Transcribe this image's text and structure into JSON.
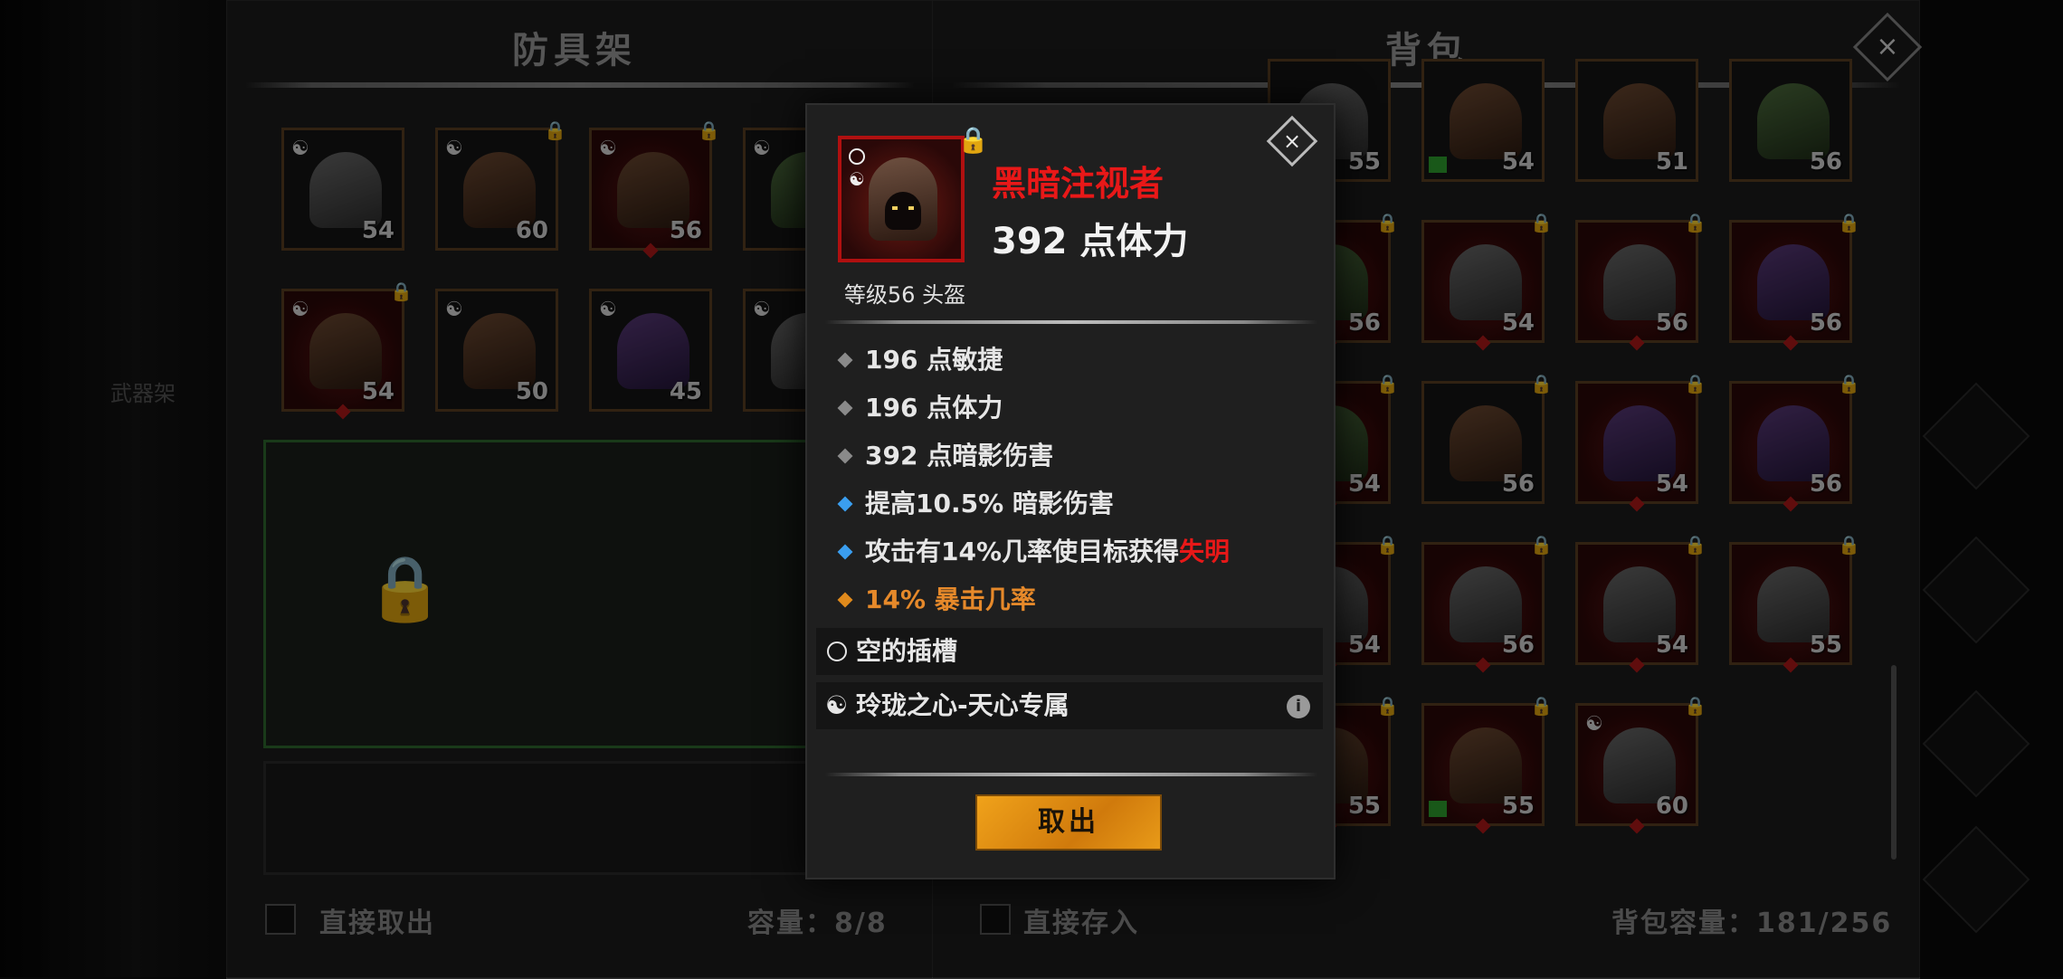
{
  "armor_rack": {
    "title": "防具架",
    "items": [
      {
        "level": "54",
        "socket": "☯",
        "locked": false,
        "style": "grey",
        "red": false
      },
      {
        "level": "60",
        "socket": "☯",
        "locked": true,
        "style": "brown",
        "red": false
      },
      {
        "level": "56",
        "socket": "☯",
        "locked": true,
        "style": "brown",
        "red": true
      },
      {
        "level": "",
        "socket": "☯",
        "locked": false,
        "style": "green",
        "red": false
      },
      {
        "level": "54",
        "socket": "☯",
        "locked": true,
        "style": "brown",
        "red": true
      },
      {
        "level": "50",
        "socket": "☯",
        "locked": false,
        "style": "brown",
        "red": false
      },
      {
        "level": "45",
        "socket": "☯",
        "locked": false,
        "style": "purple",
        "red": false
      },
      {
        "level": "",
        "socket": "☯",
        "locked": false,
        "style": "grey",
        "red": false
      }
    ],
    "direct_take_label": "直接取出",
    "capacity_label": "容量：8/8"
  },
  "backpack": {
    "title": "背包",
    "items": [
      {
        "level": "55",
        "locked": false,
        "style": "grey",
        "red": false
      },
      {
        "level": "54",
        "locked": false,
        "style": "brown",
        "red": false,
        "book": true
      },
      {
        "level": "51",
        "locked": false,
        "style": "brown",
        "red": false
      },
      {
        "level": "56",
        "locked": false,
        "style": "green",
        "red": false
      },
      {
        "level": "56",
        "locked": true,
        "style": "green",
        "red": true
      },
      {
        "level": "54",
        "locked": true,
        "style": "grey",
        "red": true
      },
      {
        "level": "56",
        "locked": true,
        "style": "grey",
        "red": true
      },
      {
        "level": "56",
        "locked": true,
        "style": "purple",
        "red": true
      },
      {
        "level": "54",
        "locked": true,
        "style": "green",
        "red": true
      },
      {
        "level": "56",
        "locked": true,
        "style": "brown",
        "red": false
      },
      {
        "level": "54",
        "locked": true,
        "style": "purple",
        "red": true
      },
      {
        "level": "56",
        "locked": true,
        "style": "purple",
        "red": true
      },
      {
        "level": "54",
        "locked": true,
        "style": "grey",
        "red": true
      },
      {
        "level": "56",
        "locked": true,
        "style": "grey",
        "red": true
      },
      {
        "level": "54",
        "locked": true,
        "style": "grey",
        "red": true
      },
      {
        "level": "55",
        "locked": true,
        "style": "grey",
        "red": true
      },
      {
        "level": "55",
        "locked": true,
        "style": "brown",
        "red": true
      },
      {
        "level": "55",
        "locked": true,
        "style": "brown",
        "red": true,
        "book": true
      },
      {
        "level": "60",
        "locked": true,
        "style": "grey",
        "red": true,
        "socket": "☯"
      }
    ],
    "direct_store_label": "直接存入",
    "capacity_label": "背包容量：181/256"
  },
  "side_menu_label": "武器架",
  "item_tooltip": {
    "name": "黑暗注视者",
    "main_stat": "392 点体力",
    "type": "等级56 头盔",
    "attributes": [
      {
        "text": "196 点敏捷",
        "color": "grey"
      },
      {
        "text": "196 点体力",
        "color": "grey"
      },
      {
        "text": "392 点暗影伤害",
        "color": "grey"
      },
      {
        "text": "提高10.5% 暗影伤害",
        "color": "blue"
      },
      {
        "text": "攻击有14%几率使目标获得",
        "highlight": "失明",
        "color": "blue"
      },
      {
        "text": "14% 暴击几率",
        "color": "orange"
      }
    ],
    "empty_socket": "空的插槽",
    "set_socket": "玲珑之心-天心专属",
    "take_button": "取出",
    "colors": {
      "name": "#e81818",
      "blue": "#3a9ef0",
      "orange": "#e6892a",
      "button": "#f0a21a"
    }
  },
  "icons": {
    "close": "×",
    "lock": "🔒",
    "yinyang": "☯",
    "info": "i"
  }
}
